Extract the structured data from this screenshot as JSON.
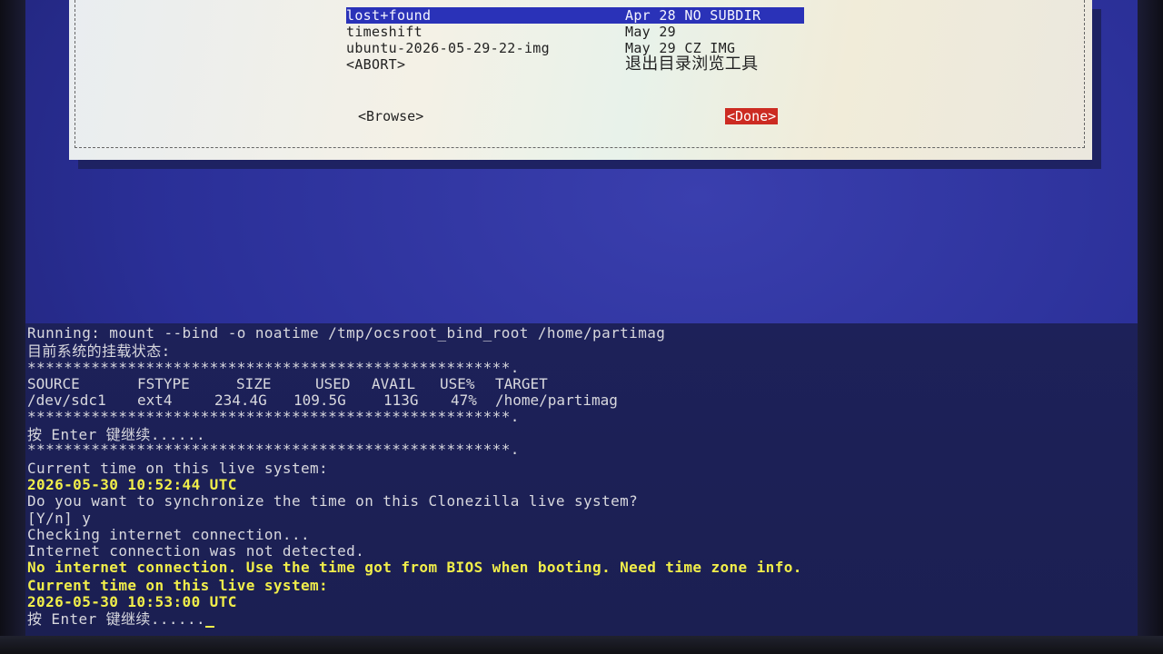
{
  "dialog": {
    "entries": [
      {
        "name": "lost+found",
        "date": "Apr 28 NO SUBDIR"
      },
      {
        "name": "timeshift",
        "date": "May 29"
      },
      {
        "name": "ubuntu-2026-05-29-22-img",
        "date": "May 29 CZ IMG"
      },
      {
        "name": "<ABORT>",
        "date": "退出目录浏览工具"
      }
    ],
    "browse_label": "<Browse>",
    "done_label": "<Done>"
  },
  "console": {
    "running": "Running: mount --bind -o noatime /tmp/ocsroot_bind_root /home/partimag",
    "mount_status": "目前系统的挂载状态:",
    "stars": "*****************************************************.",
    "table_headers": [
      "SOURCE",
      "FSTYPE",
      "SIZE",
      "USED",
      "AVAIL",
      "USE%",
      "TARGET"
    ],
    "table_row": [
      "/dev/sdc1",
      "ext4",
      "234.4G",
      "109.5G",
      "113G",
      "47%",
      "/home/partimag"
    ],
    "press_enter": "按 Enter 键继续......",
    "current_time_label": "Current time on this live system:",
    "current_time_1": "2026-05-30 10:52:44 UTC",
    "sync_question": "Do you want to synchronize the time on this Clonezilla live system?",
    "yn_answer": "[Y/n] y",
    "checking": "Checking internet connection...",
    "not_detected": "Internet connection was not detected.",
    "no_internet": "No internet connection. Use the time got from BIOS when booting. Need time zone info.",
    "current_time_label_2": "Current time on this live system:",
    "current_time_2": "2026-05-30 10:53:00 UTC",
    "press_enter_2": "按 Enter 键继续......"
  },
  "colors": {
    "selection": "#2a32b8",
    "done_button": "#cc2b22",
    "highlight_text": "#f1ee4a",
    "console_text": "#d8d8de"
  }
}
